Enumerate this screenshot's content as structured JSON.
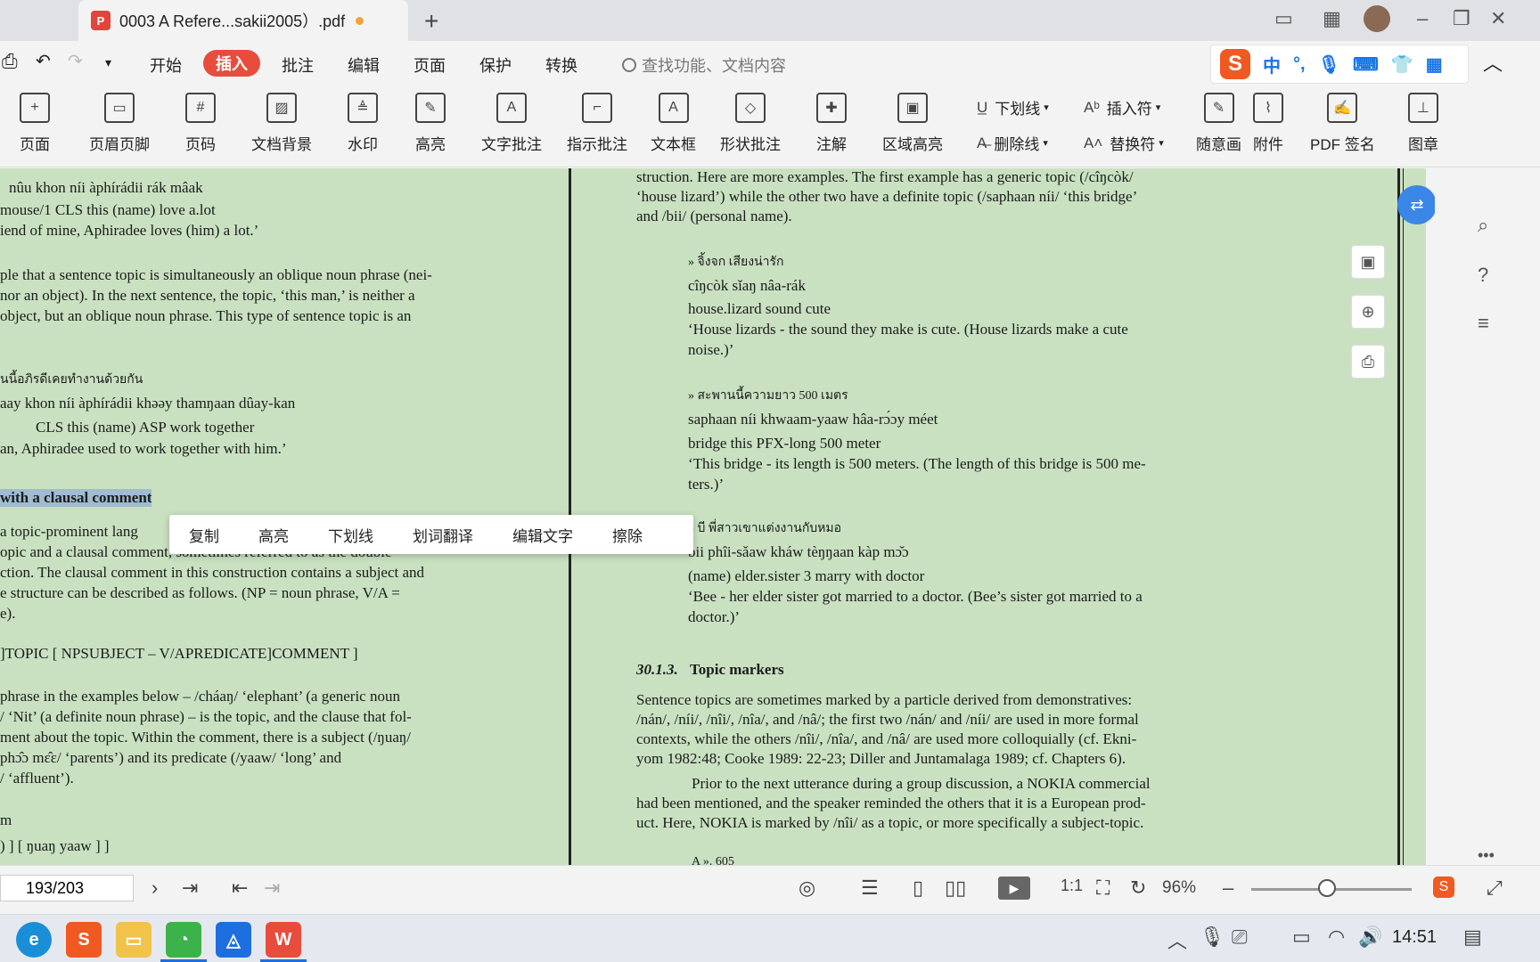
{
  "titlebar": {
    "tab_title": "0003  A Refere...sakii2005）.pdf",
    "new_tab": "+"
  },
  "menu": {
    "items": [
      "开始",
      "插入",
      "批注",
      "编辑",
      "页面",
      "保护",
      "转换"
    ],
    "active": "插入",
    "search_placeholder": "查找功能、文档内容"
  },
  "ime": {
    "logo": "S",
    "mode": "中",
    "punct": "°,"
  },
  "toolbar": {
    "tools": [
      "页面",
      "页眉页脚",
      "页码",
      "文档背景",
      "水印",
      "高亮",
      "文字批注",
      "指示批注",
      "文本框",
      "形状批注",
      "注解",
      "区域高亮"
    ],
    "small_tools": [
      "下划线",
      "插入符",
      "删除线",
      "替换符"
    ],
    "right_tools": [
      "随意画",
      "附件",
      "PDF 签名",
      "图章"
    ]
  },
  "doc_left": {
    "lines": [
      "nûu   khon  níi  àphírádii rák  mâak",
      "mouse/1  CLS  this   (name)   love a.lot",
      "iend of mine, Aphiradee loves (him) a lot.’",
      "ple that a sentence topic is simultaneously an oblique noun phrase (nei-",
      "nor an object). In the next sentence, the topic, ‘this man,’ is neither a",
      "object, but an oblique noun phrase. This type of sentence topic is an",
      "นนี้อภิรดีเคยทำงานด้วยกัน",
      "aay  khon  níi   àphírádii  khəəy  thamŋaan  dûay-kan",
      "CLS   this    (name)    ASP    work        together",
      "an, Aphiradee used to work together with him.’",
      "with a clausal comment",
      "a topic-prominent lang",
      "opic and a clausal comment, sometimes referred to as the double-",
      "ction. The clausal comment in this construction contains a subject and",
      "e structure can be described as follows. (NP = noun phrase, V/A =",
      "e).",
      "]TOPIC  [ NPSUBJECT – V/APREDICATE]COMMENT  ]",
      "phrase in the examples below – /cháaŋ/ ‘elephant’ (a generic noun",
      "/ ‘Nit’ (a definite noun phrase) – is the topic, and the clause that fol-",
      "ment about the topic. Within the comment, there is a subject (/ŋuaŋ/",
      "phɔ̂ɔ mɛ̂ɛ/   ‘parents’)   and   its   predicate   (/yaaw/   ‘long’   and",
      "/ ‘affluent’).",
      "m",
      ") ]  [ ŋuaŋ  yaaw ] ]"
    ]
  },
  "context_menu": {
    "items": [
      "复制",
      "高亮",
      "下划线",
      "划词翻译",
      "编辑文字",
      "擦除"
    ]
  },
  "doc_right": {
    "lines": [
      "struction. Here are more examples. The first example has a generic topic (/cîŋcòk/",
      "‘house lizard’) while the other two have a definite topic (/saphaan níi/ ‘this bridge’",
      "and /bii/ (personal name).",
      "» จิ้งจก เสียงน่ารัก",
      "cîŋcòk  sǐaŋ  nâa-rák",
      "house.lizard sound  cute",
      "‘House lizards - the sound they make is cute. (House lizards make a cute",
      "noise.)’",
      "» สะพานนี้ความยาว 500 เมตร",
      "saphaan níi   khwaam-yaaw  hâa-rɔ́ɔy  méet",
      "bridge   this   PFX-long            500          meter",
      "‘This bridge - its length is 500 meters. (The length of this bridge is 500 me-",
      "ters.)’",
      "»   บี    พี่สาวเขาแต่งงานกับหมอ",
      "bii   phîi-sǎaw   kháw  tèŋŋaan  kàp   mɔ̌ɔ",
      "(name) elder.sister   3          marry       with doctor",
      "‘Bee - her elder sister got married to a doctor. (Bee’s sister got married to a",
      "doctor.)’",
      "30.1.3.",
      "Topic markers",
      "Sentence topics are sometimes marked by a particle derived from demonstratives:",
      "/nán/, /níi/, /nîi/, /nîa/, and /nâ/; the first two /nán/ and /níi/ are used in more formal",
      "contexts, while the others /nîi/, /nîa/, and /nâ/ are used more colloquially (cf. Ekni-",
      "yom 1982:48; Cooke 1989: 22-23; Diller and Juntamalaga 1989; cf. Chapters 6).",
      "Prior to the next utterance during a group discussion, a NOKIA commercial",
      "had been mentioned, and the speaker reminded the others that it is a European prod-",
      "uct. Here, NOKIA is marked by /nîi/ as a topic, or more specifically a subject-topic.",
      "A ». 605"
    ]
  },
  "statusbar": {
    "page": "193/203",
    "zoom": "96%",
    "zoom_value": 0.47
  },
  "taskbar": {
    "time": "14:51"
  }
}
